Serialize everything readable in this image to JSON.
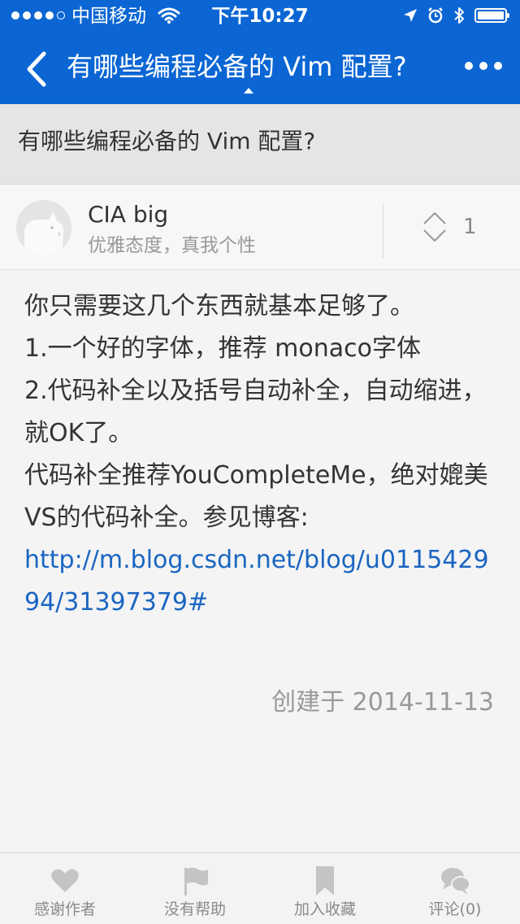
{
  "status_bar": {
    "carrier": "中国移动",
    "time": "下午10:27"
  },
  "nav": {
    "title": "有哪些编程必备的 Vim 配置?"
  },
  "question": {
    "title": "有哪些编程必备的 Vim 配置?"
  },
  "answer": {
    "author_name": "CIA big",
    "author_bio": "优雅态度，真我个性",
    "vote_count": "1",
    "body_lines": [
      "你只需要这几个东西就基本足够了。",
      "1.一个好的字体，推荐 monaco字体",
      "2.代码补全以及括号自动补全，自动缩进，就OK了。",
      "代码补全推荐YouCompleteMe，绝对媲美VS的代码补全。参见博客:"
    ],
    "link": "http://m.blog.csdn.net/blog/u011542994/31397379#",
    "created_label": "创建于",
    "created_date": "2014-11-13"
  },
  "tabs": [
    {
      "label": "感谢作者",
      "icon": "heart-icon"
    },
    {
      "label": "没有帮助",
      "icon": "flag-icon"
    },
    {
      "label": "加入收藏",
      "icon": "bookmark-icon"
    },
    {
      "label": "评论(0)",
      "icon": "comment-icon"
    }
  ],
  "colors": {
    "nav_bg": "#0b66d4",
    "link": "#1a66c2",
    "muted_text": "#999999"
  }
}
